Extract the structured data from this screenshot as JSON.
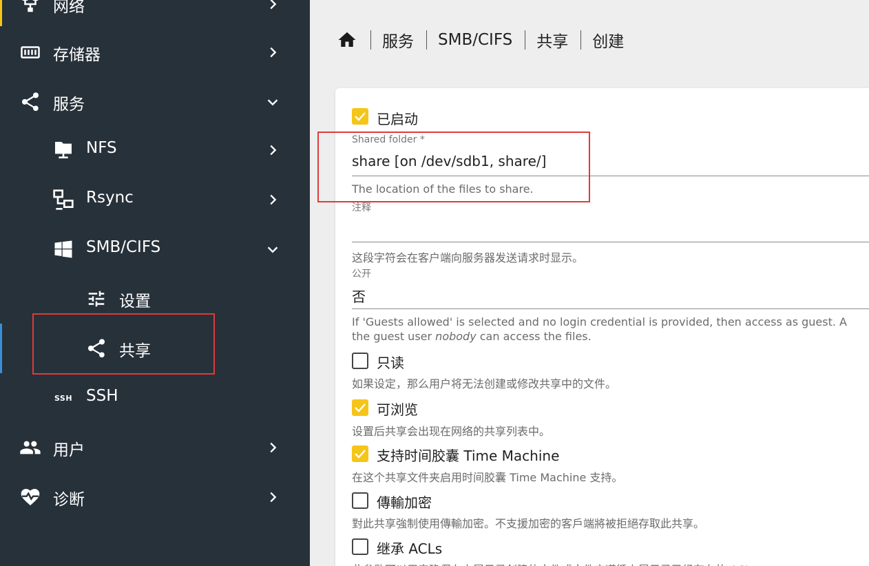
{
  "sidebar": {
    "items": [
      {
        "label": "网络",
        "icon": "network-icon"
      },
      {
        "label": "存储器",
        "icon": "storage-icon"
      },
      {
        "label": "服务",
        "icon": "share-icon"
      },
      {
        "label": "NFS",
        "icon": "nfs-folder-icon"
      },
      {
        "label": "Rsync",
        "icon": "rsync-icon"
      },
      {
        "label": "SMB/CIFS",
        "icon": "windows-icon"
      },
      {
        "label": "设置",
        "icon": "tune-icon"
      },
      {
        "label": "共享",
        "icon": "share-icon"
      },
      {
        "label": "SSH",
        "icon": "ssh-icon"
      },
      {
        "label": "用户",
        "icon": "users-icon"
      },
      {
        "label": "诊断",
        "icon": "heart-pulse-icon"
      }
    ],
    "ssh_icon_text": "SSH"
  },
  "breadcrumb": {
    "items": [
      "服务",
      "SMB/CIFS",
      "共享",
      "创建"
    ]
  },
  "form": {
    "enabled_label": "已启动",
    "shared_folder": {
      "label": "Shared folder *",
      "value": "share [on /dev/sdb1, share/]",
      "hint": "The location of the files to share."
    },
    "comment": {
      "label": "注释",
      "value": "",
      "hint": "这段字符会在客户端向服务器发送请求时显示。"
    },
    "public": {
      "label": "公开",
      "value": "否",
      "hint_line1": "If 'Guests allowed' is selected and no login credential is provided, then access as guest. A",
      "hint_line2_pre": "the guest user ",
      "hint_line2_em": "nobody",
      "hint_line2_post": " can access the files."
    },
    "readonly": {
      "label": "只读",
      "hint": "如果设定，那么用户将无法创建或修改共享中的文件。",
      "checked": false
    },
    "browsable": {
      "label": "可浏览",
      "hint": "设置后共享会出现在网络的共享列表中。",
      "checked": true
    },
    "timemachine": {
      "label": "支持时间胶囊 Time Machine",
      "hint": "在这个共享文件夹启用时间胶囊 Time Machine 支持。",
      "checked": true
    },
    "encrypt": {
      "label": "傳輸加密",
      "hint": "對此共享強制使用傳輸加密。不支援加密的客戶端將被拒絕存取此共享。",
      "checked": false
    },
    "inherit_acls": {
      "label": "继承 ACLs",
      "hint": "此参数可以用来确保在上层目录创建的文件或文件夹遵循上层目录已经存在的 ACLs。",
      "checked": false
    }
  },
  "colors": {
    "sidebar_bg": "#27313a",
    "accent_yellow": "#f5c518",
    "accent_blue": "#3a8fd6",
    "highlight_red": "#e03a3a"
  }
}
